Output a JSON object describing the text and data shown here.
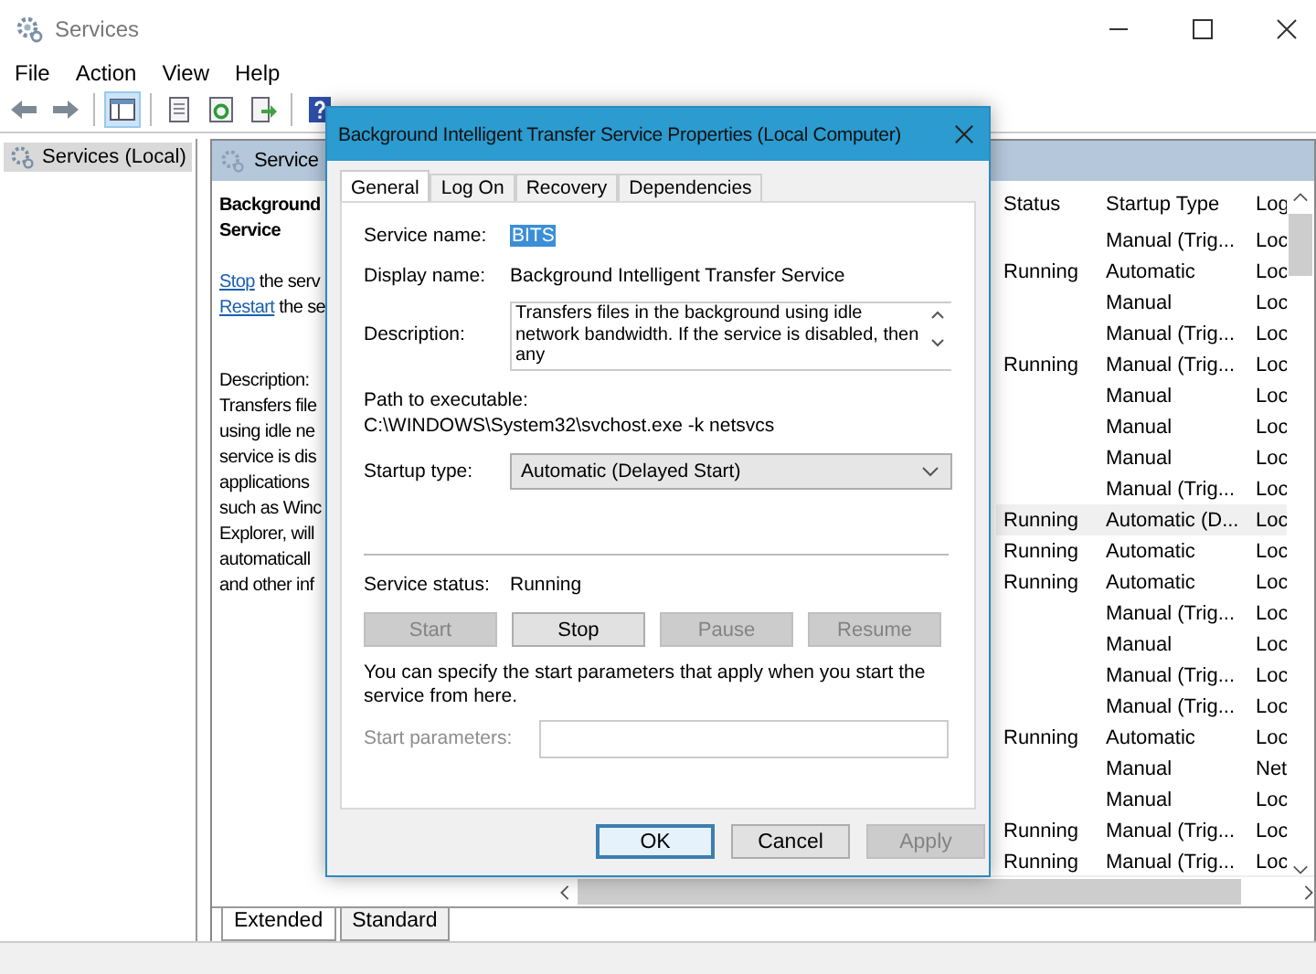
{
  "window": {
    "title": "Services"
  },
  "menu": [
    "File",
    "Action",
    "View",
    "Help"
  ],
  "toolbar": [
    {
      "kind": "back",
      "selected": false
    },
    {
      "kind": "forward",
      "selected": false
    },
    {
      "kind": "tree",
      "selected": true
    },
    {
      "kind": "properties",
      "selected": false
    },
    {
      "kind": "refresh",
      "selected": false
    },
    {
      "kind": "export",
      "selected": false
    },
    {
      "kind": "help",
      "selected": false
    }
  ],
  "tree": [
    {
      "label": "Services (Local)",
      "selected": true
    }
  ],
  "pane_header": "Service",
  "detail": {
    "title_lines": [
      "Background",
      "Service"
    ],
    "actions": [
      {
        "link": "Stop",
        "text": "the serv"
      },
      {
        "link": "Restart",
        "text": "the se"
      }
    ],
    "description_label": "Description:",
    "description_lines": [
      "Transfers file",
      "using idle ne",
      "service is dis",
      "applications",
      "such as Winc",
      "Explorer, will",
      "automaticall",
      "and other inf"
    ]
  },
  "list": {
    "columns": [
      "Status",
      "Startup Type",
      "Log"
    ],
    "rows": [
      {
        "status": "",
        "startup_type": "Manual (Trig...",
        "column_3": "Loc",
        "selected": false
      },
      {
        "status": "Running",
        "startup_type": "Automatic",
        "column_3": "Loc",
        "selected": false
      },
      {
        "status": "",
        "startup_type": "Manual",
        "column_3": "Loc",
        "selected": false
      },
      {
        "status": "",
        "startup_type": "Manual (Trig...",
        "column_3": "Loc",
        "selected": false
      },
      {
        "status": "Running",
        "startup_type": "Manual (Trig...",
        "column_3": "Loc",
        "selected": false
      },
      {
        "status": "",
        "startup_type": "Manual",
        "column_3": "Loc",
        "selected": false
      },
      {
        "status": "",
        "startup_type": "Manual",
        "column_3": "Loc",
        "selected": false
      },
      {
        "status": "",
        "startup_type": "Manual",
        "column_3": "Loc",
        "selected": false
      },
      {
        "status": "",
        "startup_type": "Manual (Trig...",
        "column_3": "Loc",
        "selected": false
      },
      {
        "status": "Running",
        "startup_type": "Automatic (D...",
        "column_3": "Loc",
        "selected": true
      },
      {
        "status": "Running",
        "startup_type": "Automatic",
        "column_3": "Loc",
        "selected": false
      },
      {
        "status": "Running",
        "startup_type": "Automatic",
        "column_3": "Loc",
        "selected": false
      },
      {
        "status": "",
        "startup_type": "Manual (Trig...",
        "column_3": "Loc",
        "selected": false
      },
      {
        "status": "",
        "startup_type": "Manual",
        "column_3": "Loc",
        "selected": false
      },
      {
        "status": "",
        "startup_type": "Manual (Trig...",
        "column_3": "Loc",
        "selected": false
      },
      {
        "status": "",
        "startup_type": "Manual (Trig...",
        "column_3": "Loc",
        "selected": false
      },
      {
        "status": "Running",
        "startup_type": "Automatic",
        "column_3": "Loc",
        "selected": false
      },
      {
        "status": "",
        "startup_type": "Manual",
        "column_3": "Net",
        "selected": false
      },
      {
        "status": "",
        "startup_type": "Manual",
        "column_3": "Loc",
        "selected": false
      },
      {
        "status": "Running",
        "startup_type": "Manual (Trig...",
        "column_3": "Loc",
        "selected": false
      },
      {
        "status": "Running",
        "startup_type": "Manual (Trig...",
        "column_3": "Loc",
        "selected": false
      }
    ]
  },
  "view_tabs": [
    {
      "label": "Extended",
      "selected": true
    },
    {
      "label": "Standard",
      "selected": false
    }
  ],
  "dialog": {
    "title": "Background Intelligent Transfer Service Properties (Local Computer)",
    "tabs": [
      {
        "label": "General",
        "selected": true
      },
      {
        "label": "Log On",
        "selected": false
      },
      {
        "label": "Recovery",
        "selected": false
      },
      {
        "label": "Dependencies",
        "selected": false
      }
    ],
    "service_name_label": "Service name:",
    "service_name": "BITS",
    "service_name_highlighted": true,
    "display_name_label": "Display name:",
    "display_name": "Background Intelligent Transfer Service",
    "description_label": "Description:",
    "description": "Transfers files in the background using idle network bandwidth. If the service is disabled, then any",
    "path_label": "Path to executable:",
    "path": "C:\\WINDOWS\\System32\\svchost.exe -k netsvcs",
    "startup_type_label": "Startup type:",
    "startup_type": "Automatic (Delayed Start)",
    "service_status_label": "Service status:",
    "service_status": "Running",
    "control_buttons": [
      {
        "label": "Start",
        "disabled": true
      },
      {
        "label": "Stop",
        "disabled": false
      },
      {
        "label": "Pause",
        "disabled": true
      },
      {
        "label": "Resume",
        "disabled": true
      }
    ],
    "hint": "You can specify the start parameters that apply when you start the service from here.",
    "start_parameters_label": "Start parameters:",
    "start_parameters_disabled": true,
    "buttons": [
      {
        "label": "OK",
        "default": true,
        "disabled": false
      },
      {
        "label": "Cancel",
        "default": false,
        "disabled": false
      },
      {
        "label": "Apply",
        "default": false,
        "disabled": true
      }
    ]
  }
}
